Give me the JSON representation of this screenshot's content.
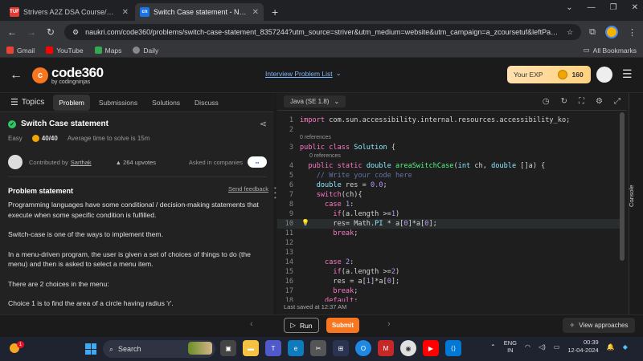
{
  "browser": {
    "tabs": [
      {
        "label": "Strivers A2Z DSA Course/Sheet",
        "favicon": "TUF",
        "active": false
      },
      {
        "label": "Switch Case statement - Naukri",
        "favicon": "cn",
        "active": true
      }
    ],
    "new_tab": "+",
    "window_controls": [
      "⌄",
      "—",
      "❐",
      "✕"
    ],
    "url": "naukri.com/code360/problems/switch-case-statement_8357244?utm_source=striver&utm_medium=website&utm_campaign=a_zcoursetuf&leftPanelTa...",
    "bookmarks": [
      "Gmail",
      "YouTube",
      "Maps",
      "Daily"
    ],
    "all_bookmarks": "All Bookmarks"
  },
  "header": {
    "logo_main": "code360",
    "logo_sub": "by codingninjas",
    "problem_list": "Interview Problem List",
    "exp_label": "Your EXP",
    "exp_value": "160"
  },
  "left": {
    "tabs": [
      "Topics",
      "Problem",
      "Submissions",
      "Solutions",
      "Discuss"
    ],
    "active_tab": "Problem",
    "title": "Switch Case statement",
    "difficulty": "Easy",
    "score": "40/40",
    "avg_time": "Average time to solve is 15m",
    "contributed_by": "Contributed by",
    "contributor": "Sarthak",
    "upvotes": "264 upvotes",
    "asked_in": "Asked in companies",
    "problem_statement_title": "Problem statement",
    "send_feedback": "Send feedback",
    "paragraphs": [
      "Programming languages have some conditional / decision-making statements that execute when some specific condition is fulfilled.",
      "Switch-case is one of the ways to implement them.",
      "In a menu-driven program, the user is given a set of choices of things to do (the menu) and then is asked to select a menu item.",
      "There are 2 choices in the menu:",
      "Choice 1 is to find the area of a circle having radius 'r'."
    ]
  },
  "editor": {
    "language": "Java (SE 1.8)",
    "references_label": "0 references",
    "last_saved": "Last saved at 12:37 AM",
    "console_label": "Console"
  },
  "actions": {
    "run": "Run",
    "submit": "Submit",
    "view_approaches": "View approaches"
  },
  "taskbar": {
    "search": "Search",
    "notification_count": "1",
    "lang_top": "ENG",
    "lang_bottom": "IN",
    "time": "00:39",
    "date": "12-04-2024"
  }
}
